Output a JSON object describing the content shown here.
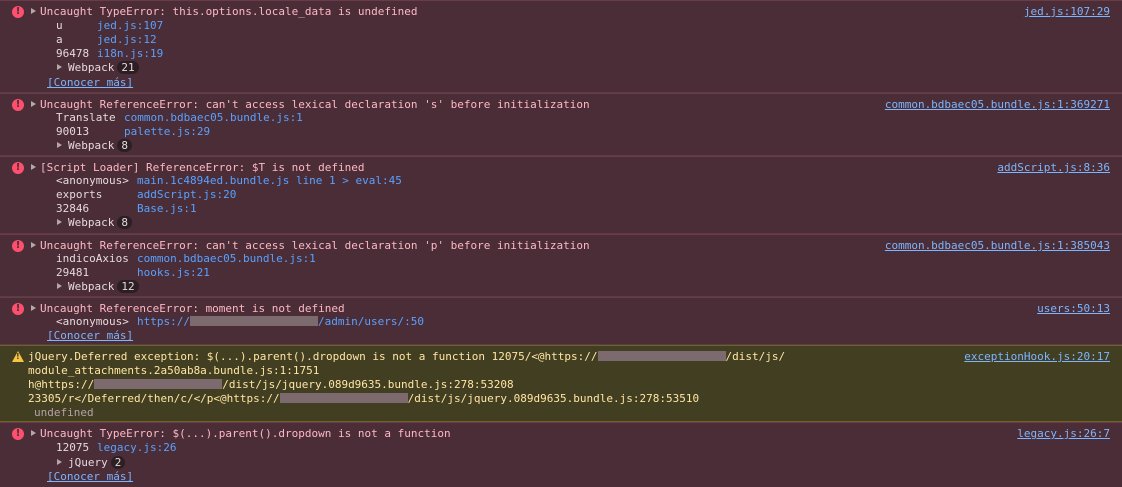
{
  "messages": [
    {
      "level": "error",
      "text": "Uncaught TypeError: this.options.locale_data is undefined",
      "source": "jed.js:107:29",
      "frames": [
        {
          "fn": "u",
          "loc": "jed.js:107"
        },
        {
          "fn": "a",
          "loc": "jed.js:12"
        },
        {
          "fn": "96478",
          "loc": "i18n.js:19"
        }
      ],
      "group": {
        "label": "Webpack",
        "count": "21"
      },
      "learn_more": "[Conocer más]"
    },
    {
      "level": "error",
      "text": "Uncaught ReferenceError: can't access lexical declaration 's' before initialization",
      "source": "common.bdbaec05.bundle.js:1:369271",
      "frames": [
        {
          "fn": "Translate",
          "loc": "common.bdbaec05.bundle.js:1"
        },
        {
          "fn": "90013",
          "loc": "palette.js:29"
        }
      ],
      "group": {
        "label": "Webpack",
        "count": "8"
      }
    },
    {
      "level": "error",
      "text": "[Script Loader] ReferenceError: $T is not defined",
      "source": "addScript.js:8:36",
      "frames": [
        {
          "fn": "<anonymous>",
          "loc": "main.1c4894ed.bundle.js line 1 > eval:45"
        },
        {
          "fn": "exports",
          "loc": "addScript.js:20"
        },
        {
          "fn": "32846",
          "loc": "Base.js:1"
        }
      ],
      "group": {
        "label": "Webpack",
        "count": "8"
      }
    },
    {
      "level": "error",
      "text": "Uncaught ReferenceError: can't access lexical declaration 'p' before initialization",
      "source": "common.bdbaec05.bundle.js:1:385043",
      "frames": [
        {
          "fn": "indicoAxios",
          "loc": "common.bdbaec05.bundle.js:1"
        },
        {
          "fn": "29481",
          "loc": "hooks.js:21"
        }
      ],
      "group": {
        "label": "Webpack",
        "count": "12"
      }
    },
    {
      "level": "error",
      "text": "Uncaught ReferenceError: moment is not defined",
      "source": "users:50:13",
      "frames": [
        {
          "fn": "<anonymous>",
          "loc_prefix": "https://",
          "loc_suffix": "/admin/users/:50"
        }
      ],
      "learn_more": "[Conocer más]"
    },
    {
      "level": "warning",
      "source": "exceptionHook.js:20:17",
      "lines": [
        {
          "before": "jQuery.Deferred exception: $(...).parent().dropdown is not a function 12075/<@https://",
          "after": "/dist/js/"
        },
        {
          "before": "module_attachments.2a50ab8a.bundle.js:1:1751",
          "after": ""
        },
        {
          "before": "h@https://",
          "after": "/dist/js/jquery.089d9635.bundle.js:278:53208"
        },
        {
          "before": "23305/r</Deferred/then/c/</p<@https://",
          "after": "/dist/js/jquery.089d9635.bundle.js:278:53510"
        }
      ],
      "result": "undefined"
    },
    {
      "level": "error",
      "text": "Uncaught TypeError: $(...).parent().dropdown is not a function",
      "source": "legacy.js:26:7",
      "frames": [
        {
          "fn": "12075",
          "loc": "legacy.js:26"
        }
      ],
      "group": {
        "label": "jQuery",
        "count": "2"
      },
      "learn_more": "[Conocer más]"
    }
  ]
}
